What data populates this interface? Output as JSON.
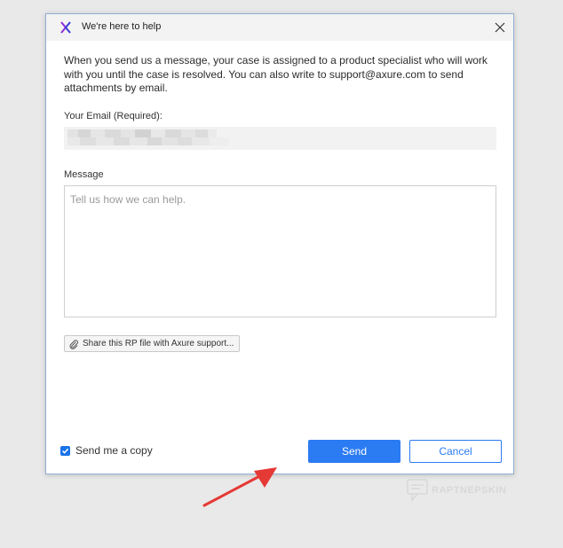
{
  "dialog": {
    "title": "We're here to help",
    "intro": "When you send us a message, your case is assigned to a product specialist who will work with you until the case is resolved. You can also write to support@axure.com to send attachments by email.",
    "email_label": "Your Email (Required):",
    "email_value_redacted": true,
    "message_label": "Message",
    "message_placeholder": "Tell us how we can help.",
    "share_button_label": "Share this RP file with Axure support...",
    "send_copy_label": "Send me a copy",
    "send_copy_checked": true,
    "send_label": "Send",
    "cancel_label": "Cancel"
  },
  "watermark": {
    "text": "RAPTNEPSKIN"
  },
  "colors": {
    "accent": "#2b7bf2",
    "arrow": "#e53935",
    "logo": "#8e2bd6"
  },
  "icons": {
    "app": "axure-logo-icon",
    "close": "close-icon",
    "attach": "paperclip-icon",
    "check": "checkmark-icon"
  }
}
